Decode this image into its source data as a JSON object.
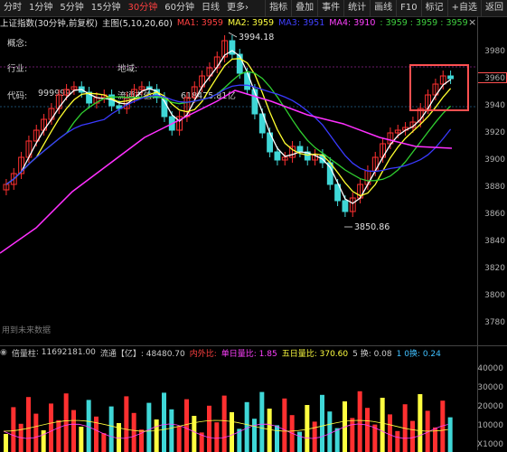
{
  "toolbar": {
    "periods": [
      "分时",
      "1分钟",
      "5分钟",
      "15分钟",
      "30分钟",
      "60分钟",
      "日线",
      "更多"
    ],
    "active_period": "30分钟",
    "more_suffix": "›",
    "right": [
      "指标",
      "叠加",
      "事件",
      "统计",
      "画线",
      "F10",
      "标记",
      "+自选",
      "返回"
    ]
  },
  "header": {
    "title": "上证指数(30分钟,前复权)",
    "chart_label": "主图(5,10,20,60)",
    "ma1": "MA1: 3959",
    "ma2": "MA2: 3959",
    "ma3": "MA3: 3951",
    "ma4": "MA4: 3910",
    "extra": ": 3959 : 3959 : 3959",
    "close_icon": "×"
  },
  "info": {
    "concept_label": "概念:",
    "industry_label": "行业:",
    "region_label": "地域:",
    "code_label": "代码:",
    "code_value": "999999",
    "float_label": "流通市值:",
    "float_value": "618475.81亿"
  },
  "annotations": {
    "high": "3994.18",
    "low": "3850.86",
    "future_note": "用到未来数据"
  },
  "price_axis": [
    "3980",
    "3960",
    "3940",
    "3920",
    "3900",
    "3880",
    "3860",
    "3840",
    "3820",
    "3800",
    "3780"
  ],
  "volume_header": {
    "label": "倍量柱",
    "value": ": 11692181.00",
    "float": "流通【亿】: 48480.70",
    "inout": "内外比:",
    "single_day": "单日量比: 1.85",
    "five_day": "五日量比: 370.60",
    "five_turn": "5 换: 0.08",
    "one_turn": "1 0换: 0.24"
  },
  "volume_axis": [
    "40000",
    "30000",
    "20000",
    "10000",
    "X1000"
  ],
  "colors": {
    "up": "#ff3030",
    "down": "#3fd7d7",
    "ma1": "#ffffff",
    "ma2": "#ffff30",
    "ma3": "#3a3aff",
    "ma4": "#ff30ff",
    "green": "#30d030",
    "highlight": "#ff5050"
  },
  "icons": {
    "price_line": "price-line-icon"
  }
}
